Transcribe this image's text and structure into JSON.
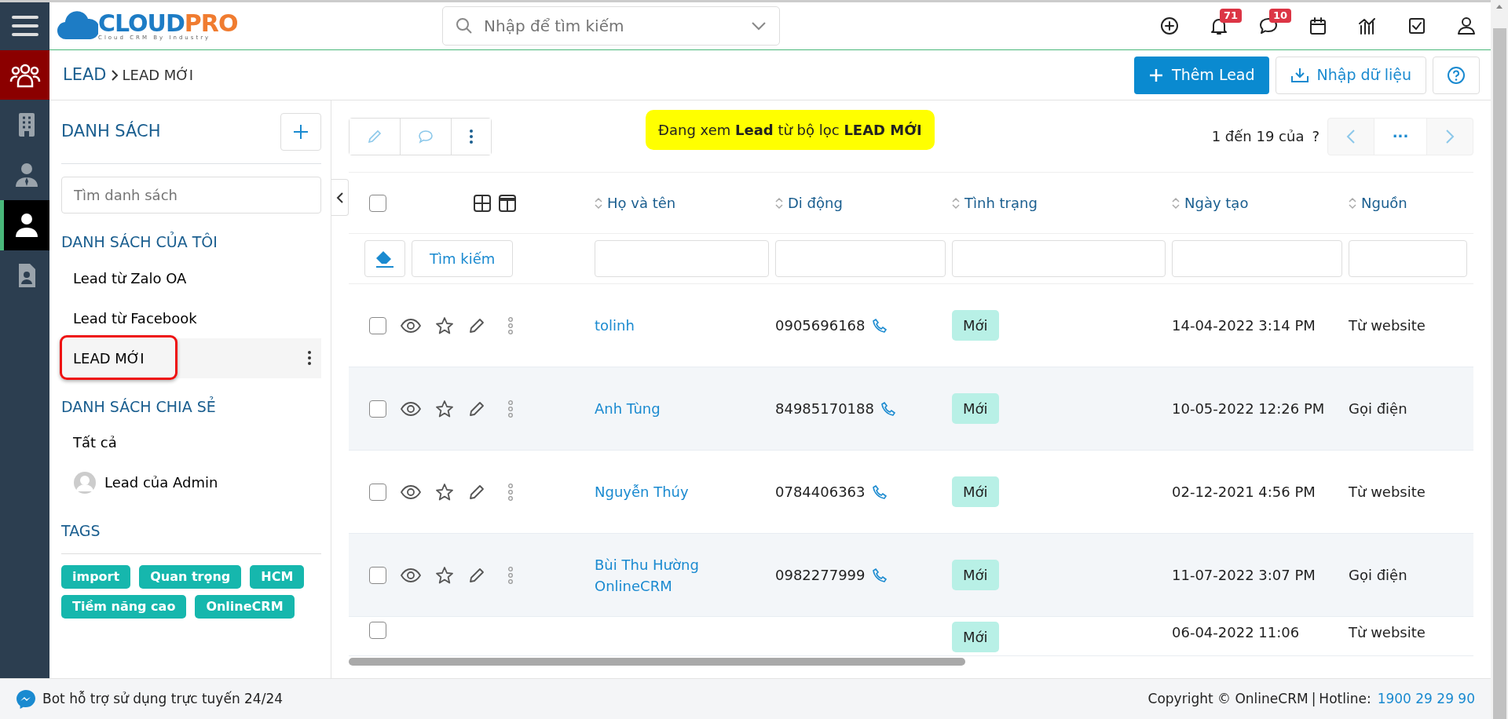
{
  "logo": {
    "text": "CLOUDPRO",
    "tagline": "Cloud CRM By Industry"
  },
  "search": {
    "placeholder": "Nhập để tìm kiếm"
  },
  "notifications": {
    "badge": "71"
  },
  "messages": {
    "badge": "10"
  },
  "rail": [
    {
      "selected": false
    },
    {
      "selected": false
    },
    {
      "selected": true
    },
    {
      "selected": false
    }
  ],
  "breadcrumb": [
    "LEAD",
    "LEAD MỚI"
  ],
  "header_buttons": [
    {
      "kind": "primary",
      "label": "Thêm Lead"
    },
    {
      "kind": "import",
      "label": "Nhập dữ liệu"
    },
    {
      "kind": "help"
    }
  ],
  "sidebar": {
    "title": "DANH SÁCH",
    "search_placeholder": "Tìm danh sách",
    "sections": [
      {
        "title": "DANH SÁCH CỦA TÔI",
        "items": [
          {
            "label": "Lead từ Zalo OA",
            "kind": "plain",
            "selected": false,
            "callout": false
          },
          {
            "label": "Lead từ Facebook",
            "kind": "plain",
            "selected": false,
            "callout": false
          },
          {
            "label": "LEAD MỚI",
            "kind": "plain",
            "selected": true,
            "callout": true
          }
        ]
      },
      {
        "title": "DANH SÁCH CHIA SẺ",
        "items": [
          {
            "label": "Tất cả",
            "kind": "plain",
            "selected": false,
            "callout": false
          },
          {
            "label": "Lead của Admin",
            "kind": "user",
            "selected": false,
            "callout": false
          }
        ]
      }
    ],
    "tags_title": "TAGS",
    "tags": [
      "import",
      "Quan trọng",
      "HCM",
      "Tiềm năng cao",
      "OnlineCRM"
    ]
  },
  "filter_banner": "Đang xem **Lead** từ bộ lọc **LEAD MỚI**",
  "pagination": {
    "range": "1 đến 19 của",
    "total": "?",
    "more": "···"
  },
  "table": {
    "columns": [
      "Họ và tên",
      "Di động",
      "Tình trạng",
      "Ngày tạo",
      "Nguồn"
    ],
    "search_button": "Tìm kiếm",
    "select_all_checked": false,
    "rows": [
      {
        "checked": false,
        "name": "tolinh",
        "phone": "0905696168",
        "status": "Mới",
        "created": "14-04-2022 3:14 PM",
        "source": "Từ website"
      },
      {
        "checked": false,
        "name": "Anh Tùng",
        "phone": "84985170188",
        "status": "Mới",
        "created": "10-05-2022 12:26 PM",
        "source": "Gọi điện"
      },
      {
        "checked": false,
        "name": "Nguyễn Thúy",
        "phone": "0784406363",
        "status": "Mới",
        "created": "02-12-2021 4:56 PM",
        "source": "Từ website"
      },
      {
        "checked": false,
        "name": "Bùi Thu Hường OnlineCRM",
        "phone": "0982277999",
        "status": "Mới",
        "created": "11-07-2022 3:07 PM",
        "source": "Gọi điện"
      },
      {
        "checked": false,
        "status": "Mới",
        "created": "06-04-2022 11:06",
        "source": "Từ website"
      }
    ]
  },
  "footer": {
    "bot": "Bot hỗ trợ sử dụng trực tuyến 24/24",
    "copyright": "Copyright © OnlineCRM",
    "separator": "|",
    "hotline_label": "Hotline:",
    "hotline": "1900 29 29 90"
  }
}
